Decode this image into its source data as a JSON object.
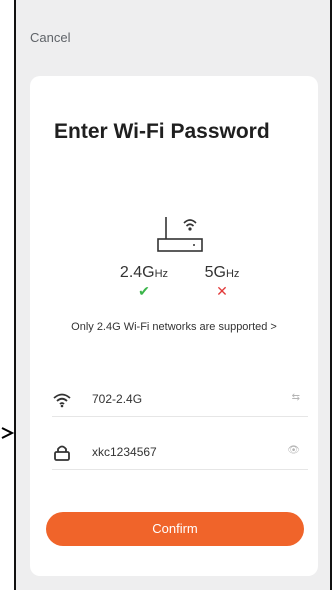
{
  "header": {
    "cancel_label": "Cancel"
  },
  "card": {
    "title": "Enter Wi-Fi Password",
    "bands": [
      {
        "main": "2.4G",
        "unit": "Hz",
        "status": "✔"
      },
      {
        "main": "5G",
        "unit": "Hz",
        "status": "✕"
      }
    ],
    "note": "Only 2.4G Wi-Fi networks are supported >",
    "fields": {
      "network": {
        "value": "702-2.4G",
        "trail": "⇆"
      },
      "password": {
        "value": "xkc1234567",
        "trail": "👁"
      }
    },
    "confirm_label": "Confirm"
  },
  "colors": {
    "accent": "#f0642a",
    "ok": "#3bb54a",
    "bad": "#e23b3b"
  }
}
